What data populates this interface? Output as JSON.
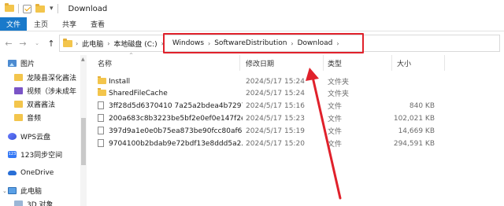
{
  "window": {
    "title": "Download"
  },
  "ribbon": {
    "tabs": [
      "文件",
      "主页",
      "共享",
      "查看"
    ]
  },
  "address": {
    "crumbs": [
      "此电脑",
      "本地磁盘 (C:)",
      "Windows",
      "SoftwareDistribution",
      "Download"
    ]
  },
  "nav": {
    "items": [
      {
        "label": "图片",
        "icon": "pictures-icon"
      },
      {
        "label": "龙陵县深化酱法",
        "icon": "folder-icon"
      },
      {
        "label": "视频（涉未成年",
        "icon": "video-icon"
      },
      {
        "label": "双酱酱法",
        "icon": "folder-icon"
      },
      {
        "label": "音频",
        "icon": "folder-icon"
      },
      {
        "label": "WPS云盘",
        "icon": "wps-cloud-icon"
      },
      {
        "label": "123同步空间",
        "icon": "sync-space-icon"
      },
      {
        "label": "OneDrive",
        "icon": "onedrive-icon"
      },
      {
        "label": "此电脑",
        "icon": "pc-icon"
      },
      {
        "label": "3D 对象",
        "icon": "3d-objects-icon"
      }
    ]
  },
  "list": {
    "headers": {
      "name": "名称",
      "date": "修改日期",
      "type": "类型",
      "size": "大小"
    },
    "rows": [
      {
        "name": "Install",
        "date": "2024/5/17 15:24",
        "type": "文件夹",
        "size": "",
        "kind": "folder"
      },
      {
        "name": "SharedFileCache",
        "date": "2024/5/17 15:24",
        "type": "文件夹",
        "size": "",
        "kind": "folder"
      },
      {
        "name": "3ff28d5d6370410 7a25a2bdea4b7297...",
        "date": "2024/5/17 15:16",
        "type": "文件",
        "size": "840 KB",
        "kind": "file"
      },
      {
        "name": "200a683c8b3223be5bf2e0ef0e147f2e...",
        "date": "2024/5/17 15:23",
        "type": "文件",
        "size": "102,021 KB",
        "kind": "file"
      },
      {
        "name": "397d9a1e0e0b75ea873be90fcc80af6...",
        "date": "2024/5/17 15:19",
        "type": "文件",
        "size": "14,669 KB",
        "kind": "file"
      },
      {
        "name": "9704100b2bdab9e72bdf13e8ddd5a2...",
        "date": "2024/5/17 15:20",
        "type": "文件",
        "size": "294,591 KB",
        "kind": "file"
      }
    ]
  },
  "colors": {
    "accent": "#1979ca",
    "highlight": "#e0212b"
  }
}
